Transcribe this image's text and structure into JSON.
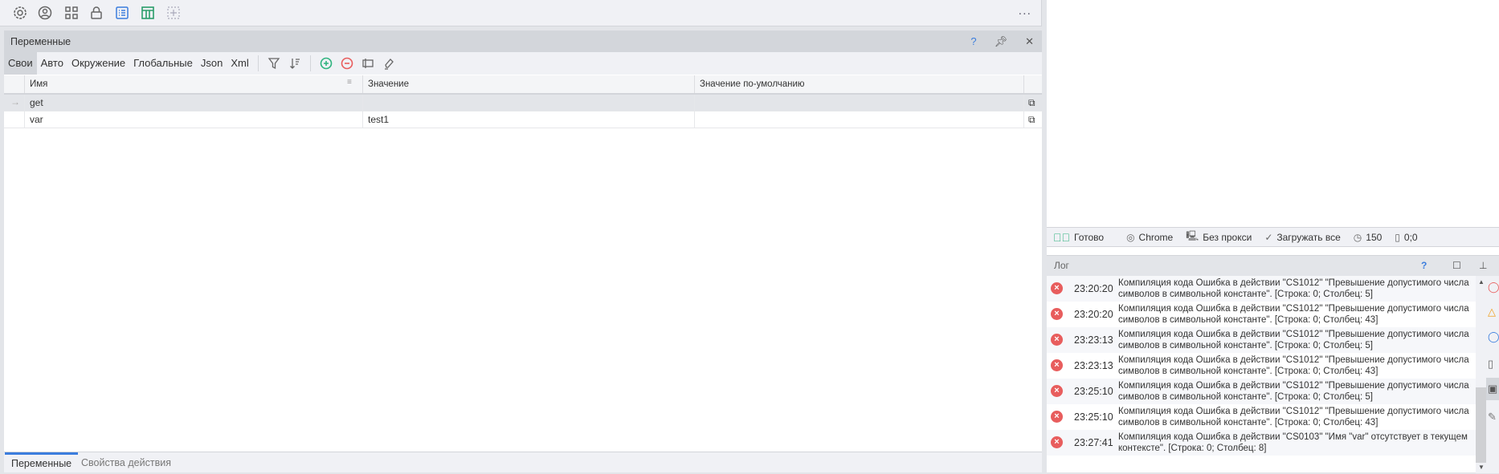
{
  "toolbar": {
    "icons": [
      "gear-icon",
      "user-icon",
      "grid-icon",
      "lock-icon",
      "list-icon",
      "table-icon",
      "add-icon"
    ],
    "more": "..."
  },
  "variables_panel": {
    "title": "Переменные",
    "help": "?",
    "pin": "⊥",
    "close": "✕",
    "tabs": [
      "Свои",
      "Авто",
      "Окружение",
      "Глобальные",
      "Json",
      "Xml"
    ],
    "columns": [
      "Имя",
      "Значение",
      "Значение по-умолчанию"
    ],
    "rows": [
      {
        "name": "get",
        "value": "",
        "default": ""
      },
      {
        "name": "var",
        "value": "test1",
        "default": ""
      }
    ],
    "row_marker": "→"
  },
  "bottom_tabs": [
    "Переменные",
    "Свойства действия"
  ],
  "status": {
    "ready": "Готово",
    "browser": "Chrome",
    "proxy": "Без прокси",
    "load": "Загружать все",
    "timeout": "150",
    "coords": "0;0"
  },
  "log": {
    "title": "Лог",
    "help": "?",
    "entries": [
      {
        "time": "23:20:20",
        "text": "Компиляция кода  Ошибка в действии \"CS1012\" \"Превышение допустимого числа символов в символьной константе\". [Строка: 0; Столбец: 5]"
      },
      {
        "time": "23:20:20",
        "text": "Компиляция кода  Ошибка в действии \"CS1012\" \"Превышение допустимого числа символов в символьной константе\". [Строка: 0; Столбец: 43]"
      },
      {
        "time": "23:23:13",
        "text": "Компиляция кода  Ошибка в действии \"CS1012\" \"Превышение допустимого числа символов в символьной константе\". [Строка: 0; Столбец: 5]"
      },
      {
        "time": "23:23:13",
        "text": "Компиляция кода  Ошибка в действии \"CS1012\" \"Превышение допустимого числа символов в символьной константе\". [Строка: 0; Столбец: 43]"
      },
      {
        "time": "23:25:10",
        "text": "Компиляция кода  Ошибка в действии \"CS1012\" \"Превышение допустимого числа символов в символьной константе\". [Строка: 0; Столбец: 5]"
      },
      {
        "time": "23:25:10",
        "text": "Компиляция кода  Ошибка в действии \"CS1012\" \"Превышение допустимого числа символов в символьной константе\". [Строка: 0; Столбец: 43]"
      },
      {
        "time": "23:27:41",
        "text": "Компиляция кода  Ошибка в действии \"CS0103\" \"Имя \"var\" отсутствует в текущем контексте\". [Строка: 0; Столбец: 8]"
      }
    ]
  },
  "colors": {
    "accent": "#3b7ddd",
    "green": "#2fb37e",
    "red": "#e85d5d"
  }
}
